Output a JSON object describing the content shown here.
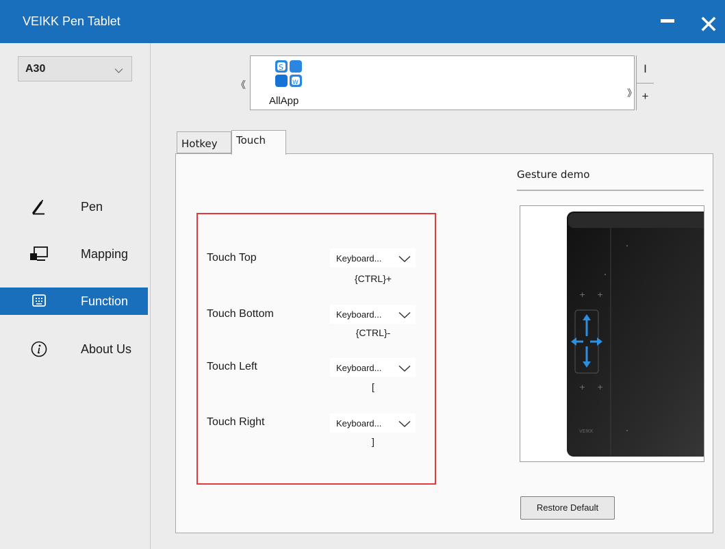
{
  "window": {
    "title": "VEIKK Pen Tablet",
    "minimize_icon": "minimize-icon",
    "close_icon": "close-icon"
  },
  "sidebar": {
    "device": "A30",
    "items": [
      {
        "label": "Pen",
        "icon": "pen-icon",
        "active": false
      },
      {
        "label": "Mapping",
        "icon": "monitor-icon",
        "active": false
      },
      {
        "label": "Function",
        "icon": "keyboard-icon",
        "active": true
      },
      {
        "label": "About Us",
        "icon": "info-icon",
        "active": false
      }
    ]
  },
  "apps": {
    "prev_label": "《",
    "next_label": "》",
    "items": [
      {
        "label": "AllApp",
        "icon": "all-apps-icon"
      }
    ],
    "remove_label": "I",
    "add_label": "+"
  },
  "tabs": [
    {
      "label": "Hotkey",
      "active": false
    },
    {
      "label": "Touch",
      "active": true
    }
  ],
  "touch": {
    "rows": [
      {
        "label": "Touch Top",
        "mode": "Keyboard...",
        "value": "{CTRL}+"
      },
      {
        "label": "Touch Bottom",
        "mode": "Keyboard...",
        "value": "{CTRL}-"
      },
      {
        "label": "Touch Left",
        "mode": "Keyboard...",
        "value": "["
      },
      {
        "label": "Touch Right",
        "mode": "Keyboard...",
        "value": "]"
      }
    ]
  },
  "gesture": {
    "title": "Gesture demo",
    "brand_mark": "VEIKK"
  },
  "restore_label": "Restore Default",
  "colors": {
    "accent": "#1a6fbd",
    "highlight_border": "#e5383b",
    "gesture_arrow": "#2d8fe0"
  }
}
